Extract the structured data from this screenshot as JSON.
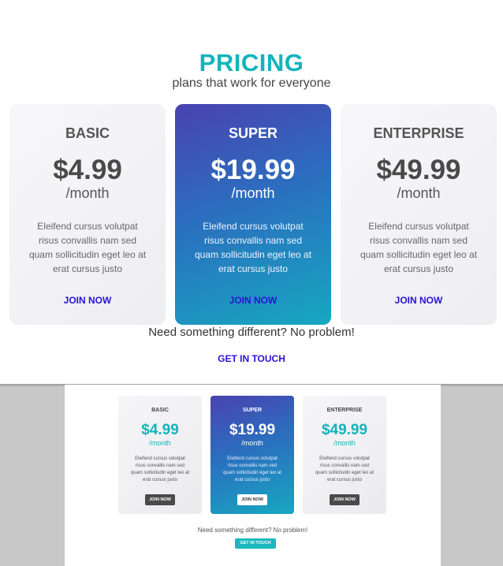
{
  "main": {
    "title": "PRICING",
    "subtitle": "plans that work for everyone",
    "plans": [
      {
        "name": "BASIC",
        "price": "$4.99",
        "period": "/month",
        "description": "Eleifend cursus volutpat risus convallis nam sed quam sollicitudin eget leo at erat cursus justo",
        "cta": "JOIN NOW"
      },
      {
        "name": "SUPER",
        "price": "$19.99",
        "period": "/month",
        "description": "Eleifend cursus volutpat risus convallis nam sed quam sollicitudin eget leo at erat cursus justo",
        "cta": "JOIN NOW"
      },
      {
        "name": "ENTERPRISE",
        "price": "$49.99",
        "period": "/month",
        "description": "Eleifend cursus volutpat risus convallis nam sed quam sollicitudin eget leo at erat cursus justo",
        "cta": "JOIN NOW"
      }
    ],
    "footer_text": "Need something different? No problem!",
    "footer_cta": "GET IN TOUCH"
  },
  "preview": {
    "plans": [
      {
        "name": "BASIC",
        "price": "$4.99",
        "period": "/month",
        "description": "Eleifend cursus volutpat risus convallis nam sed quam sollicitudin eget leo at erat cursus justo",
        "cta": "JOIN NOW"
      },
      {
        "name": "SUPER",
        "price": "$19.99",
        "period": "/month",
        "description": "Eleifend cursus volutpat risus convallis nam sed quam sollicitudin eget leo at erat cursus justo",
        "cta": "JOIN NOW"
      },
      {
        "name": "ENTERPRISE",
        "price": "$49.99",
        "period": "/month",
        "description": "Eleifend cursus volutpat risus convallis nam sed quam sollicitudin eget leo at erat cursus justo",
        "cta": "JOIN NOW"
      }
    ],
    "footer_text": "Need something different? No problem!",
    "footer_cta": "GET IN TOUCH"
  },
  "colors": {
    "accent_teal": "#13b4bb",
    "link_blue": "#2a12d6",
    "featured_gradient_start": "#4a42b0",
    "featured_gradient_end": "#16a8c0"
  }
}
